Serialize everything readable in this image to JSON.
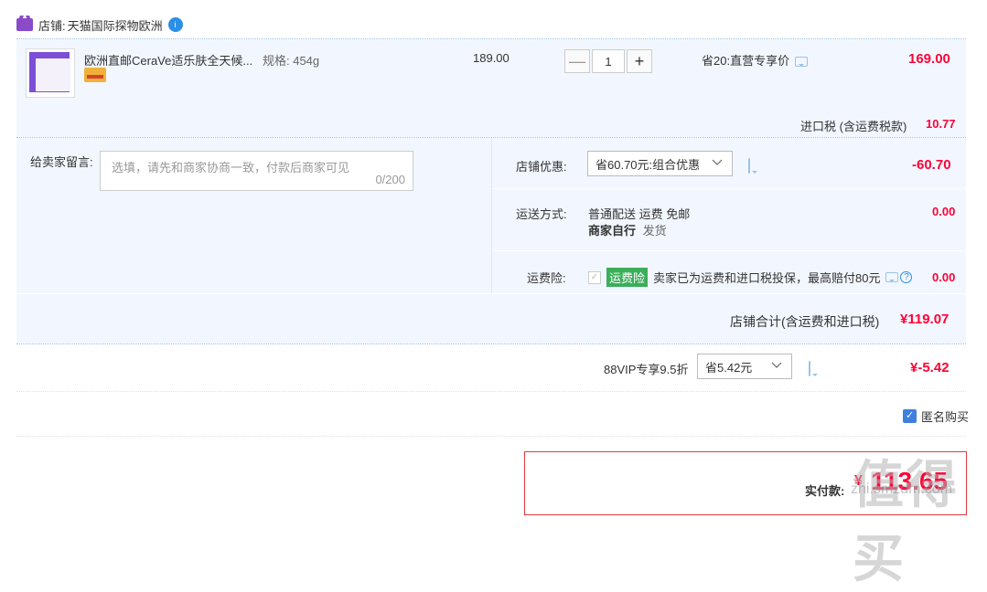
{
  "shop": {
    "label": "店铺:",
    "name": "天猫国际探物欧洲",
    "chat_badge": "i"
  },
  "item": {
    "title": "欧洲直邮CeraVe适乐肤全天候...",
    "spec": "规格: 454g",
    "price": "189.00",
    "quantity": "1",
    "minus": "—",
    "plus": "+",
    "promo": "省20:直营专享价",
    "total": "169.00"
  },
  "tax": {
    "label": "进口税 (含运费税款)",
    "value": "10.77"
  },
  "message": {
    "label": "给卖家留言:",
    "placeholder": "选填，请先和商家协商一致，付款后商家可见",
    "counter": "0/200"
  },
  "discount": {
    "label": "店铺优惠:",
    "selected": "省60.70元:组合优惠",
    "value": "-60.70"
  },
  "shipping": {
    "label": "运送方式:",
    "line1": "普通配送 运费 免邮",
    "line2_bold": "商家自行",
    "line2_rest": "发货",
    "value": "0.00"
  },
  "insurance": {
    "label": "运费险:",
    "tag": "运费险",
    "text": "卖家已为运费和进口税投保，最高赔付80元",
    "help": "?",
    "value": "0.00"
  },
  "shop_total": {
    "label": "店铺合计(含运费和进口税)",
    "value": "¥119.07"
  },
  "vip": {
    "label": "88VIP专享9.5折",
    "selected": "省5.42元",
    "value": "¥-5.42"
  },
  "anonymous": {
    "label": "匿名购买",
    "checked": true
  },
  "pay": {
    "label": "实付款:",
    "currency": "¥",
    "value": "113.65"
  },
  "watermark": {
    "text": "值得买",
    "url": "zhi.smzdm.com"
  },
  "colors": {
    "accent_red": "#ff0036",
    "panel_blue": "#f2f7ff",
    "border_blue": "#9cc3e6"
  }
}
